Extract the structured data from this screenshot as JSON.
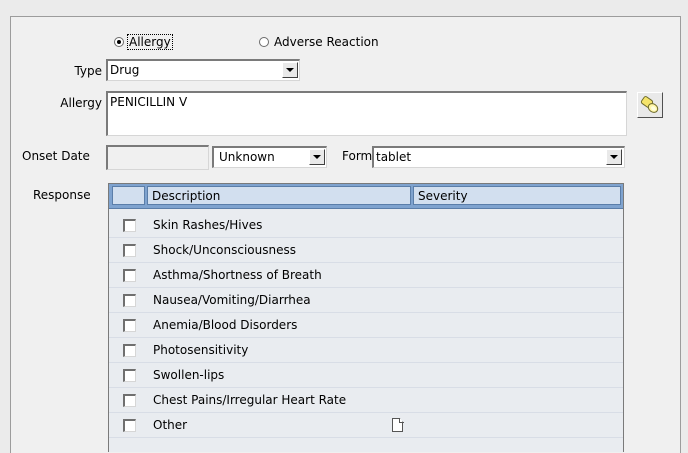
{
  "kind": {
    "options": [
      "Allergy",
      "Adverse Reaction"
    ],
    "selected": "Allergy"
  },
  "type": {
    "label": "Type",
    "value": "Drug"
  },
  "allergy": {
    "label": "Allergy",
    "value": "PENICILLIN V",
    "lookup_icon": "flashlight-search-icon"
  },
  "onset": {
    "label": "Onset Date",
    "date_value": "",
    "precision_value": "Unknown"
  },
  "form": {
    "label": "Form",
    "value": "tablet"
  },
  "response": {
    "label": "Response",
    "columns": [
      "Description",
      "Severity"
    ],
    "rows": [
      {
        "description": "Skin Rashes/Hives",
        "checked": false
      },
      {
        "description": "Shock/Unconsciousness",
        "checked": false
      },
      {
        "description": "Asthma/Shortness of Breath",
        "checked": false
      },
      {
        "description": "Nausea/Vomiting/Diarrhea",
        "checked": false
      },
      {
        "description": "Anemia/Blood Disorders",
        "checked": false
      },
      {
        "description": "Photosensitivity",
        "checked": false
      },
      {
        "description": "Swollen-lips",
        "checked": false
      },
      {
        "description": "Chest Pains/Irregular Heart Rate",
        "checked": false
      },
      {
        "description": "Other",
        "checked": false,
        "icon": "document-icon"
      }
    ]
  },
  "colors": {
    "grid_header": "#7fa3cf",
    "header_cell": "#d2dfef",
    "grid_body": "#e9ecf0"
  }
}
